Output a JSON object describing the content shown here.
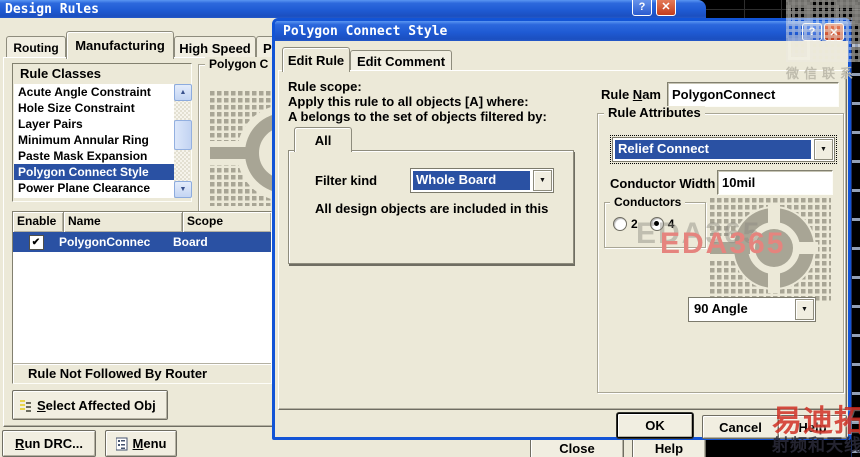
{
  "colors": {
    "selection_blue": "#2a51a3",
    "titlebar_blue": "#1f5bd4",
    "dialog_face": "#ece9d8",
    "hatch_gray": "#a8a595",
    "watermark_red": "#ce281c",
    "eda365_salmon": "#e5847e"
  },
  "icons": {
    "help_glyph": "?",
    "close_glyph": "✕",
    "dropdown_arrow": "▼",
    "scroll_up": "▲",
    "scroll_down": "▼",
    "check": "✔"
  },
  "parent_window": {
    "title": "Design Rules",
    "tabs": [
      {
        "label": "Routing"
      },
      {
        "label": "Manufacturing"
      },
      {
        "label": "High Speed"
      },
      {
        "label": "P"
      }
    ],
    "rule_classes": {
      "title": "Rule Classes",
      "items": [
        "Acute Angle Constraint",
        "Hole Size Constraint",
        "Layer Pairs",
        "Minimum Annular Ring",
        "Paste Mask Expansion",
        "Polygon Connect Style",
        "Power Plane Clearance"
      ],
      "selected_item": "Polygon Connect Style"
    },
    "preview_group_label": "Polygon C",
    "rules_table": {
      "columns": [
        "Enable",
        "Name",
        "Scope"
      ],
      "rows": [
        {
          "enabled": true,
          "name": "PolygonConnec",
          "scope": "Board"
        }
      ]
    },
    "router_note": "Rule Not Followed By Router",
    "select_affected_button": {
      "accel": "S",
      "rest": "elect Affected Obj"
    },
    "run_drc_button": {
      "accel": "R",
      "rest": "un DRC..."
    },
    "menu_button": {
      "accel": "M",
      "rest": "enu"
    },
    "close_button": "Close",
    "help_button": "Help"
  },
  "dialog": {
    "title": "Polygon Connect Style",
    "tabs": [
      {
        "label": "Edit Rule"
      },
      {
        "label": "Edit Comment"
      }
    ],
    "scope": {
      "heading": "Rule scope:",
      "line1": "Apply this rule to all objects [A] where:",
      "line2": "A belongs to the set of objects filtered by:",
      "tab_label": "All",
      "filter_kind_label": "Filter kind",
      "filter_kind_value": "Whole Board",
      "note": "All design objects are included in this"
    },
    "rule_name": {
      "label_pre": "Rule ",
      "label_accel": "N",
      "label_rest": "am",
      "value": "PolygonConnect"
    },
    "attributes": {
      "group_title": "Rule Attributes",
      "connect_style_value": "Relief Connect",
      "conductor_width_label": "Conductor Width",
      "conductor_width_value": "10mil",
      "conductors_group_title": "Conductors",
      "radio_options": [
        {
          "label": "2",
          "selected": false
        },
        {
          "label": "4",
          "selected": true
        }
      ],
      "angle_value": "90 Angle"
    },
    "ok_button": "OK",
    "cancel_button": "Cancel",
    "help_button": "Help"
  },
  "watermarks": {
    "eda365": "EDA365",
    "wechat_text": "微信联系",
    "brand_line1": "易迪拓培训",
    "brand_line2": "射频和天线设计专家"
  }
}
